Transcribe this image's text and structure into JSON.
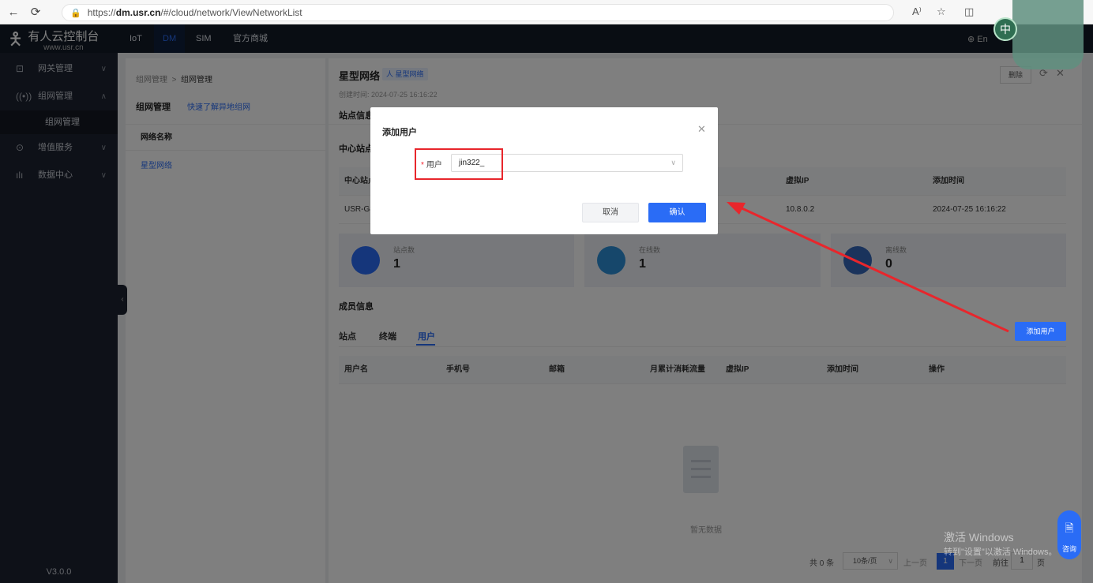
{
  "browser": {
    "url_prefix": "https://",
    "url_host": "dm.usr.cn",
    "url_path": "/#/cloud/network/ViewNetworkList"
  },
  "topnav": {
    "logo_title": "有人云控制台",
    "logo_sub": "www.usr.cn",
    "items": [
      "IoT",
      "DM",
      "SIM",
      "官方商城"
    ],
    "lang": "En"
  },
  "sidebar": {
    "items": [
      {
        "label": "网关管理",
        "icon": "gateway-icon"
      },
      {
        "label": "组网管理",
        "icon": "network-icon"
      },
      {
        "label": "增值服务",
        "icon": "service-icon"
      },
      {
        "label": "数据中心",
        "icon": "chart-icon"
      }
    ],
    "sub_item": "组网管理",
    "version": "V3.0.0"
  },
  "left_panel": {
    "breadcrumb_parent": "组网管理",
    "breadcrumb_sep": ">",
    "breadcrumb_current": "组网管理",
    "title": "组网管理",
    "quick_link": "快速了解异地组网",
    "column": "网络名称",
    "row": "星型网络"
  },
  "detail": {
    "title": "星型网络",
    "tag": "人 星型网络",
    "created": "创建时间: 2024-07-25 16:16:22",
    "delete_label": "删除",
    "site_info": "站点信息",
    "center_site": "中心站点",
    "table_head": {
      "col1": "中心站点",
      "col2": "虚拟IP",
      "col3": "添加时间"
    },
    "table_row": {
      "col1": "USR-G8",
      "col2": "10.8.0.2",
      "col3": "2024-07-25 16:16:22"
    },
    "stats": [
      {
        "label": "站点数",
        "value": "1"
      },
      {
        "label": "在线数",
        "value": "1"
      },
      {
        "label": "离线数",
        "value": "0"
      }
    ],
    "member_info": "成员信息",
    "tabs": [
      "站点",
      "终端",
      "用户"
    ],
    "active_tab": "用户",
    "add_user_label": "添加用户",
    "user_columns": [
      "用户名",
      "手机号",
      "邮箱",
      "月累计消耗流量",
      "虚拟IP",
      "添加时间",
      "操作"
    ],
    "empty_text": "暂无数据",
    "pagination": {
      "total": "共 0 条",
      "page_size": "10条/页",
      "prev": "上一页",
      "current": "1",
      "next": "下一页",
      "goto": "前往",
      "goto_value": "1",
      "page_unit": "页"
    }
  },
  "dialog": {
    "title": "添加用户",
    "field_label": "用户",
    "field_value": "jin322_",
    "cancel_label": "取消",
    "confirm_label": "确认"
  },
  "watermark": {
    "line1": "激活 Windows",
    "line2": "转到\"设置\"以激活 Windows。"
  },
  "consult_label": "咨询",
  "avatar_char": "中",
  "colors": {
    "accent": "#2a6cf6",
    "nav_bg": "#121a26",
    "sidebar_bg": "#1c2230",
    "highlight": "#e8262c"
  }
}
